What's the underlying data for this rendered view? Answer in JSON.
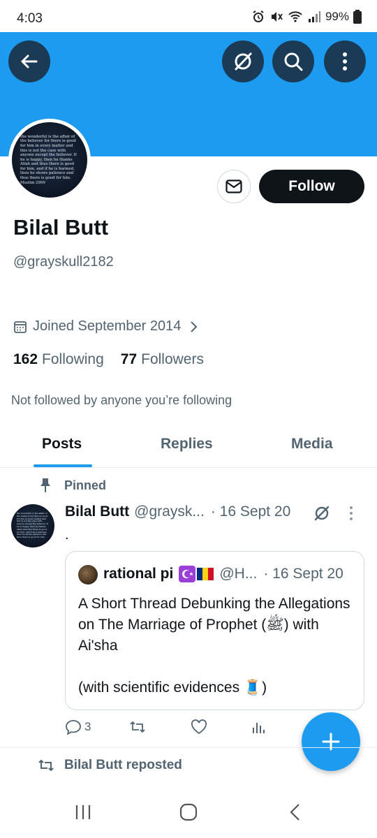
{
  "status_bar": {
    "time": "4:03",
    "battery": "99%"
  },
  "header": {
    "back_icon": "arrow-left-icon",
    "grok_icon": "grok-icon",
    "search_icon": "search-icon",
    "more_icon": "more-vertical-icon",
    "banner_color": "#1d9bf0"
  },
  "profile": {
    "avatar_quote": "the wonderful is the affair of the believer for there is good for him in every matter and this is not the case with anyone except the believer. If he is happy, then he thanks Allah and thus there is good for him, and if he is harmed, then he shows patience and thus there is good for him.",
    "avatar_source": "Muslim 2999",
    "follow_label": "Follow",
    "name": "Bilal Butt",
    "handle": "@grayskull2182",
    "joined": "Joined September 2014",
    "following_count": "162",
    "following_label": "Following",
    "followers_count": "77",
    "followers_label": "Followers",
    "not_followed": "Not followed by anyone you’re following"
  },
  "tabs": [
    {
      "label": "Posts",
      "active": true
    },
    {
      "label": "Replies",
      "active": false
    },
    {
      "label": "Media",
      "active": false
    }
  ],
  "pinned_post": {
    "pinned_label": "Pinned",
    "author_name": "Bilal Butt",
    "author_handle": "@graysk...",
    "date": "· 16 Sept 20",
    "text": ".",
    "quote": {
      "author_name": "rational pi",
      "author_handle": "@H...",
      "date": "· 16 Sept 20",
      "text": "A Short Thread Debunking the Allegations on The Marriage of Prophet (ﷺ) with Ai'sha\n\n(with scientific evidences 🧵)"
    },
    "actions": {
      "reply_count": "3",
      "repost_count": "",
      "like_count": "",
      "views_count": ""
    }
  },
  "next_post": {
    "reposted_label": "Bilal Butt reposted"
  },
  "accent_color": "#1d9bf0"
}
